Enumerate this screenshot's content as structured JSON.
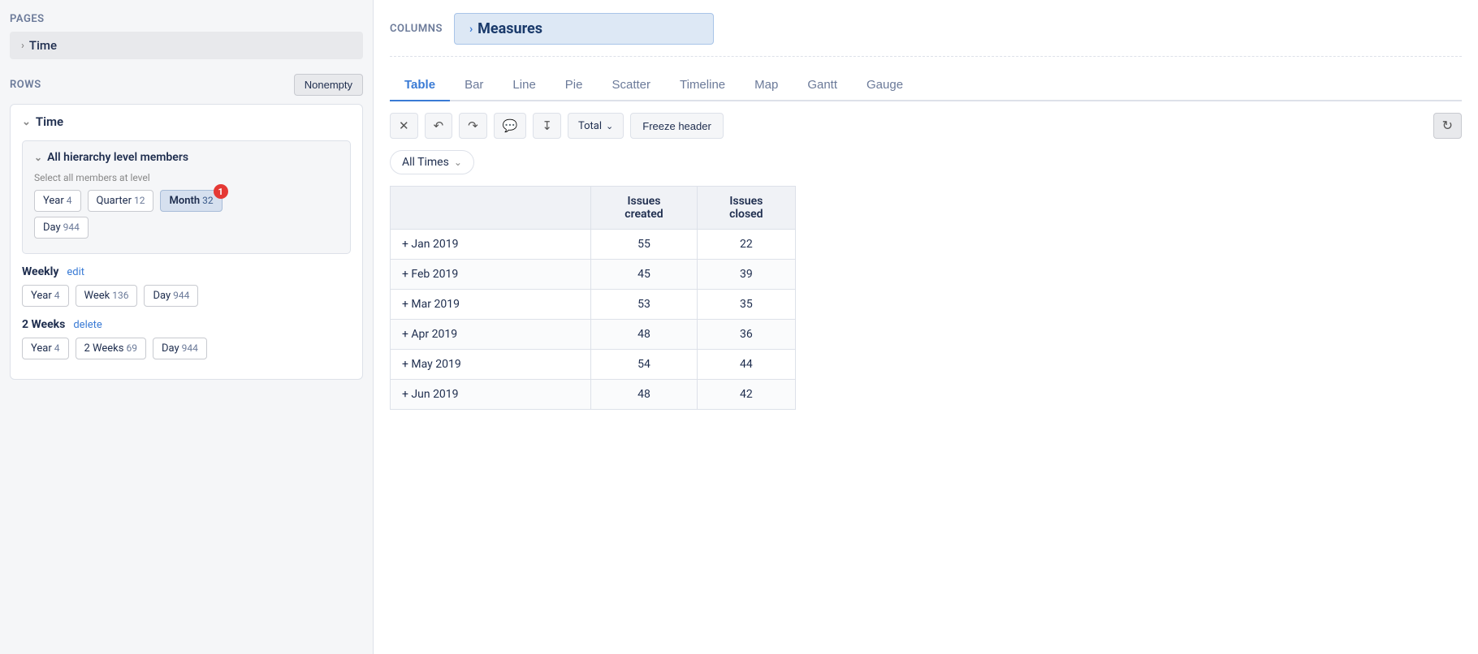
{
  "left": {
    "pages_label": "Pages",
    "time_pill": "Time",
    "rows_label": "Rows",
    "nonempty_btn": "Nonempty",
    "time_section": "Time",
    "hierarchy": {
      "title": "All hierarchy level members",
      "select_label": "Select all members at level",
      "levels": [
        {
          "name": "Year",
          "count": "4",
          "active": false
        },
        {
          "name": "Quarter",
          "count": "12",
          "active": false
        },
        {
          "name": "Month",
          "count": "32",
          "active": true,
          "badge": "1"
        },
        {
          "name": "Day",
          "count": "944",
          "active": false
        }
      ]
    },
    "weekly": {
      "label": "Weekly",
      "edit_link": "edit",
      "levels": [
        {
          "name": "Year",
          "count": "4",
          "active": false
        },
        {
          "name": "Week",
          "count": "136",
          "active": false
        },
        {
          "name": "Day",
          "count": "944",
          "active": false
        }
      ]
    },
    "two_weeks": {
      "label": "2 Weeks",
      "delete_link": "delete",
      "levels": [
        {
          "name": "Year",
          "count": "4",
          "active": false
        },
        {
          "name": "2 Weeks",
          "count": "69",
          "active": false
        },
        {
          "name": "Day",
          "count": "944",
          "active": false
        }
      ]
    }
  },
  "right": {
    "columns_label": "Columns",
    "measures_label": "Measures",
    "tabs": [
      {
        "id": "table",
        "label": "Table",
        "active": true
      },
      {
        "id": "bar",
        "label": "Bar",
        "active": false
      },
      {
        "id": "line",
        "label": "Line",
        "active": false
      },
      {
        "id": "pie",
        "label": "Pie",
        "active": false
      },
      {
        "id": "scatter",
        "label": "Scatter",
        "active": false
      },
      {
        "id": "timeline",
        "label": "Timeline",
        "active": false
      },
      {
        "id": "map",
        "label": "Map",
        "active": false
      },
      {
        "id": "gantt",
        "label": "Gantt",
        "active": false
      },
      {
        "id": "gauge",
        "label": "Gauge",
        "active": false
      }
    ],
    "toolbar": {
      "total_btn": "Total",
      "freeze_btn": "Freeze header"
    },
    "filter": {
      "label": "All Times"
    },
    "table": {
      "columns": [
        "Issues created",
        "Issues closed"
      ],
      "rows": [
        {
          "label": "+ Jan 2019",
          "issues_created": "55",
          "issues_closed": "22"
        },
        {
          "label": "+ Feb 2019",
          "issues_created": "45",
          "issues_closed": "39"
        },
        {
          "label": "+ Mar 2019",
          "issues_created": "53",
          "issues_closed": "35"
        },
        {
          "label": "+ Apr 2019",
          "issues_created": "48",
          "issues_closed": "36"
        },
        {
          "label": "+ May 2019",
          "issues_created": "54",
          "issues_closed": "44"
        },
        {
          "label": "+ Jun 2019",
          "issues_created": "48",
          "issues_closed": "42"
        }
      ]
    }
  }
}
